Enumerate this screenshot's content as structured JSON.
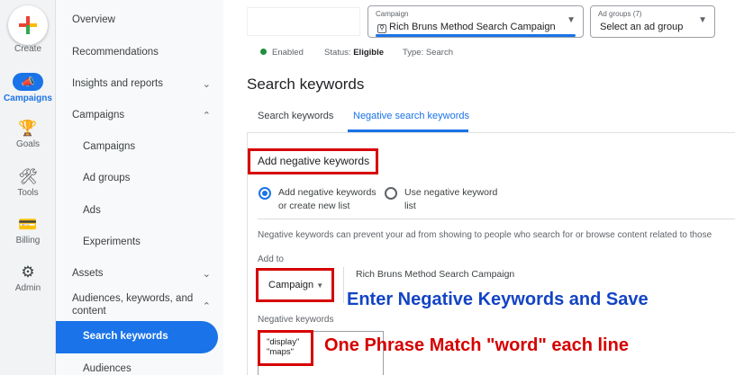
{
  "rail": {
    "create": "Create",
    "campaigns": "Campaigns",
    "goals": "Goals",
    "tools": "Tools",
    "billing": "Billing",
    "admin": "Admin"
  },
  "nav": {
    "overview": "Overview",
    "recommendations": "Recommendations",
    "insights": "Insights and reports",
    "campaigns_section": "Campaigns",
    "campaigns": "Campaigns",
    "ad_groups": "Ad groups",
    "ads": "Ads",
    "experiments": "Experiments",
    "assets": "Assets",
    "audiences_line1": "Audiences, keywords, and",
    "audiences_line2": "content",
    "search_keywords": "Search keywords",
    "audiences": "Audiences"
  },
  "topbar": {
    "campaign_label": "Campaign",
    "campaign_value": "Rich Bruns Method Search Campaign",
    "adgroups_label": "Ad groups (7)",
    "adgroups_value": "Select an ad group"
  },
  "status": {
    "enabled": "Enabled",
    "status_label": "Status:",
    "status_value": "Eligible",
    "type_label": "Type:",
    "type_value": "Search"
  },
  "page": {
    "title": "Search keywords",
    "tabs": [
      "Search keywords",
      "Negative search keywords"
    ]
  },
  "form": {
    "section_title": "Add negative keywords",
    "radio1_line1": "Add negative keywords",
    "radio1_line2": "or create new list",
    "radio2_line1": "Use negative keyword",
    "radio2_line2": "list",
    "help_text": "Negative keywords can prevent your ad from showing to people who search for or browse content related to those",
    "add_to_label": "Add to",
    "add_to_value": "Campaign",
    "campaign_name": "Rich Bruns Method Search Campaign",
    "negative_keywords_label": "Negative keywords",
    "keywords": [
      "\"display\"",
      "\"maps\""
    ]
  },
  "annotations": {
    "blue": "Enter Negative Keywords and Save",
    "red": "One Phrase Match \"word\" each line"
  },
  "colors": {
    "accent": "#1a73e8",
    "annotation_red": "#d60000",
    "annotation_blue": "#1344c4",
    "enabled_green": "#1e8e3e"
  }
}
